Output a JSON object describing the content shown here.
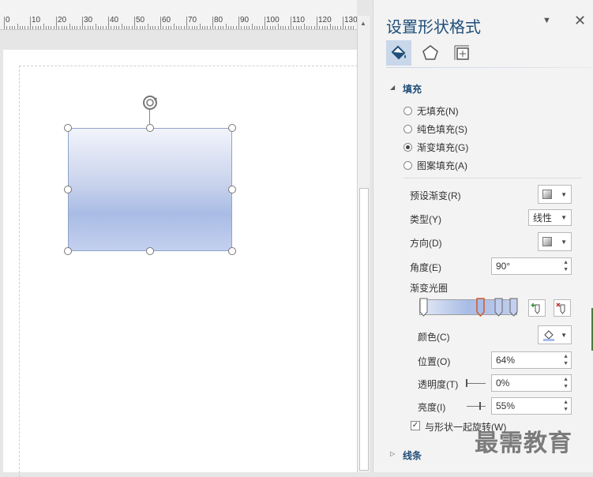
{
  "ruler": {
    "numbers": [
      "0",
      "10",
      "20",
      "30",
      "40",
      "50",
      "60",
      "70",
      "80",
      "90",
      "100",
      "110",
      "120",
      "130"
    ]
  },
  "pane": {
    "title": "设置形状格式",
    "dropdown_icon": "chevron-down-icon",
    "close_icon": "close-icon",
    "tabs": [
      "fill-line-icon",
      "effects-pentagon-icon",
      "size-properties-icon"
    ],
    "fill": {
      "header": "填充",
      "options": [
        {
          "label": "无填充(N)",
          "selected": false
        },
        {
          "label": "纯色填充(S)",
          "selected": false
        },
        {
          "label": "渐变填充(G)",
          "selected": true
        },
        {
          "label": "图案填充(A)",
          "selected": false
        }
      ],
      "preset_label": "预设渐变(R)",
      "type_label": "类型(Y)",
      "type_value": "线性",
      "direction_label": "方向(D)",
      "angle_label": "角度(E)",
      "angle_value": "90°",
      "stops_label": "渐变光圈",
      "color_label": "颜色(C)",
      "position_label": "位置(O)",
      "position_value": "64%",
      "transparency_label": "透明度(T)",
      "transparency_value": "0%",
      "brightness_label": "亮度(I)",
      "brightness_value": "55%",
      "rotate_label": "与形状一起旋转(W)",
      "rotate_checked": true
    },
    "line_header": "线条",
    "watermark": "最需教育"
  },
  "colors": {
    "accent": "#1f4e79",
    "selected_stop": "#d4572a"
  }
}
